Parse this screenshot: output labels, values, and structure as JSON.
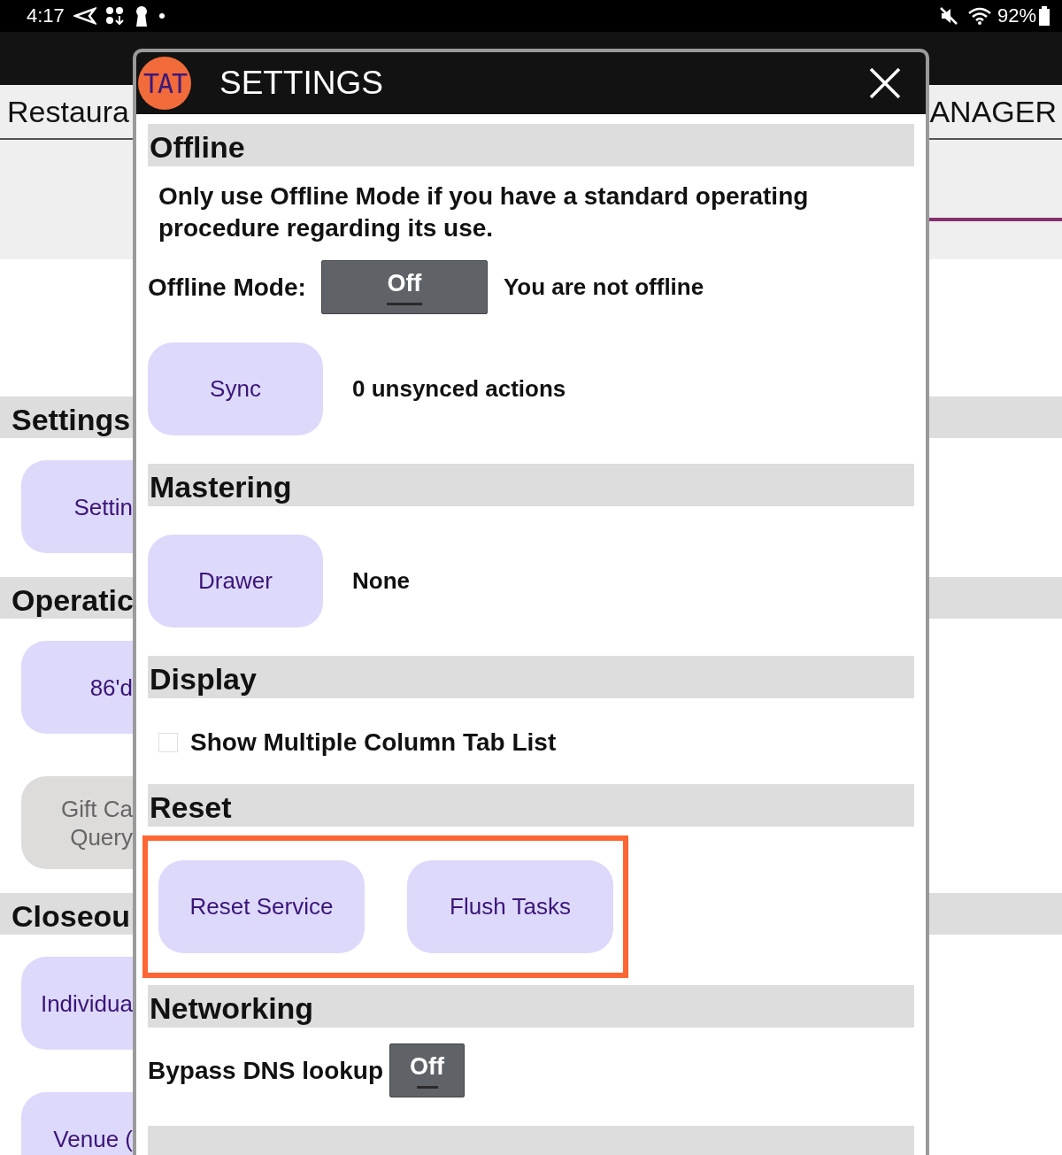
{
  "status_bar": {
    "time": "4:17",
    "battery": "92%"
  },
  "background": {
    "header": {
      "left_title": "Restaura",
      "right_title": "ANAGER"
    },
    "sections": [
      {
        "heading": "Settings",
        "buttons": [
          {
            "label": "Settin",
            "disabled": false
          }
        ]
      },
      {
        "heading": "Operatic",
        "buttons": [
          {
            "label": "86'd",
            "disabled": false
          },
          {
            "label": "Gift Ca\nQuery",
            "disabled": true
          }
        ]
      },
      {
        "heading": "Closeou",
        "buttons": [
          {
            "label": "Individua",
            "disabled": false
          },
          {
            "label": "Venue (",
            "disabled": false
          }
        ]
      }
    ]
  },
  "dialog": {
    "logo_text": "TAT",
    "title": "SETTINGS",
    "sections": [
      {
        "heading": "Offline",
        "rows": [
          {
            "kind": "paragraph",
            "text": "Only use Offline Mode if you have a standard operating procedure regarding its use."
          },
          {
            "kind": "wide-toggle",
            "label": "Offline Mode:",
            "value": "Off",
            "on": false,
            "note": "You are not offline"
          },
          {
            "kind": "button",
            "button": "Sync",
            "note": "0 unsynced actions"
          }
        ]
      },
      {
        "heading": "Mastering",
        "rows": [
          {
            "kind": "button",
            "button": "Drawer",
            "note": "None"
          }
        ]
      },
      {
        "heading": "Display",
        "rows": [
          {
            "kind": "checkbox",
            "label": "Show Multiple Column Tab List",
            "checked": false
          }
        ]
      },
      {
        "heading": "Reset",
        "rows": [
          {
            "kind": "buttons",
            "highlighted": true,
            "buttons": [
              "Reset Service",
              "Flush Tasks"
            ]
          }
        ]
      },
      {
        "heading": "Networking",
        "rows": [
          {
            "kind": "toggle",
            "label": "Bypass DNS lookup",
            "value": "Off",
            "on": false
          }
        ]
      }
    ]
  }
}
